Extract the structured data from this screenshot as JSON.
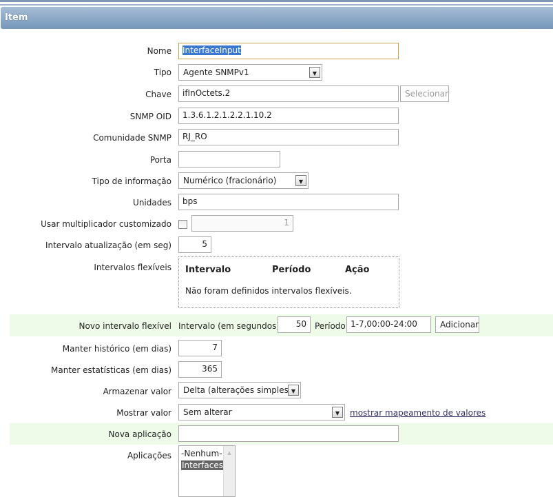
{
  "header": {
    "title": "Item"
  },
  "form": {
    "nome": {
      "label": "Nome",
      "value": "InterfaceInput"
    },
    "tipo": {
      "label": "Tipo",
      "value": "Agente SNMPv1"
    },
    "chave": {
      "label": "Chave",
      "value": "ifInOctets.2",
      "button": "Selecionar"
    },
    "snmp_oid": {
      "label": "SNMP OID",
      "value": "1.3.6.1.2.1.2.2.1.10.2"
    },
    "comunidade": {
      "label": "Comunidade SNMP",
      "value": "RJ_RO"
    },
    "porta": {
      "label": "Porta",
      "value": ""
    },
    "tipo_info": {
      "label": "Tipo de informação",
      "value": "Numérico (fracionário)"
    },
    "unidades": {
      "label": "Unidades",
      "value": "bps"
    },
    "multiplicador": {
      "label": "Usar multiplicador customizado",
      "checked": false,
      "value": "1"
    },
    "intervalo": {
      "label": "Intervalo atualização (em seg)",
      "value": "5"
    },
    "flex": {
      "label": "Intervalos flexíveis",
      "columns": [
        "Intervalo",
        "Período",
        "Ação"
      ],
      "empty": "Não foram definidos intervalos flexíveis."
    },
    "novo_flex": {
      "label": "Novo intervalo flexível",
      "interval_label": "Intervalo (em segundos)",
      "interval_value": "50",
      "period_label": "Período",
      "period_value": "1-7,00:00-24:00",
      "button": "Adicionar"
    },
    "historico": {
      "label": "Manter histórico (em dias)",
      "value": "7"
    },
    "estatisticas": {
      "label": "Manter estatísticas (em dias)",
      "value": "365"
    },
    "armazenar": {
      "label": "Armazenar valor",
      "value": "Delta (alterações simples)"
    },
    "mostrar": {
      "label": "Mostrar valor",
      "value": "Sem alterar",
      "link": "mostrar mapeamento de valores"
    },
    "nova_app": {
      "label": "Nova aplicação",
      "value": ""
    },
    "aplicacoes": {
      "label": "Aplicações",
      "options": [
        "-Nenhum-",
        "Interfaces"
      ],
      "selected": "Interfaces"
    }
  }
}
